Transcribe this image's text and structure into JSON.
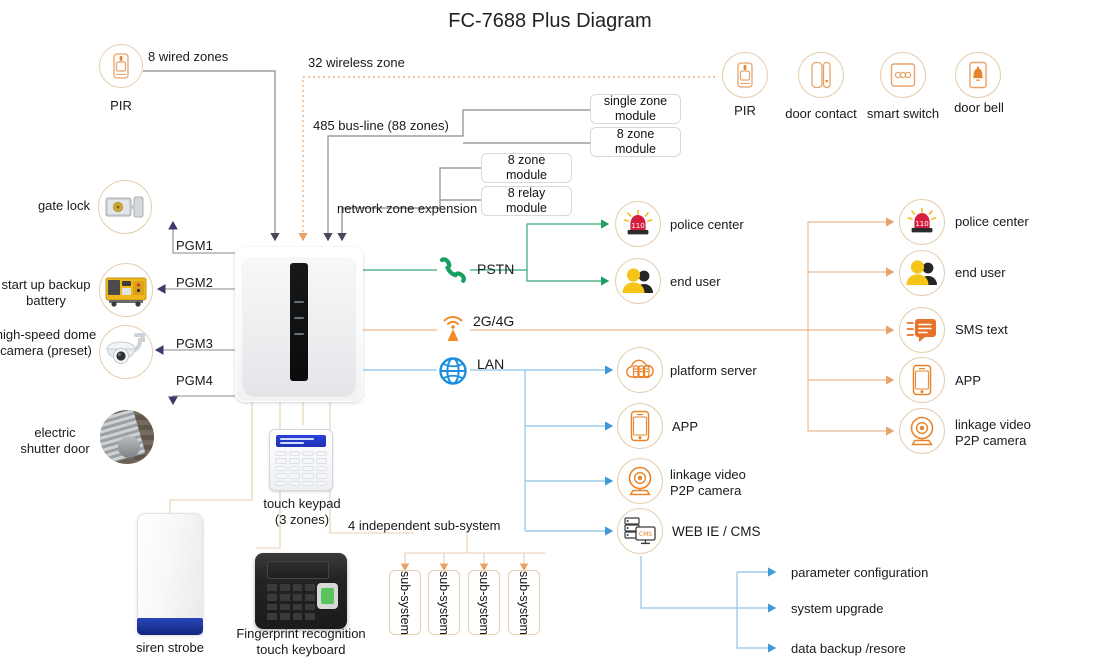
{
  "title": "FC-7688 Plus Diagram",
  "colors": {
    "orange": "#e8a36a",
    "orange_icon": "#e8832a",
    "green": "#1f9b63",
    "blue": "#59a9dd",
    "gray_line": "#8a8a8a",
    "dark_arrow": "#3b3a6b",
    "chip_border": "#e6cdb0"
  },
  "inputs": {
    "wired": {
      "label": "8 wired zones",
      "device": "PIR"
    },
    "wireless": {
      "label": "32 wireless zone"
    },
    "bus": {
      "label": "485 bus-line (88 zones)"
    },
    "network": {
      "label": "network zone expension"
    }
  },
  "modules": [
    {
      "name": "single zone module",
      "line1": "single zone",
      "line2": "module"
    },
    {
      "name": "8 zone module",
      "line1": "8 zone",
      "line2": "module"
    },
    {
      "name": "8 zone module",
      "line1": "8 zone",
      "line2": "module"
    },
    {
      "name": "8 relay module",
      "line1": "8 relay",
      "line2": "module"
    }
  ],
  "wireless_devices": [
    {
      "label": "PIR",
      "icon": "pir-icon"
    },
    {
      "label": "door contact",
      "icon": "door-contact-icon"
    },
    {
      "label": "smart switch",
      "icon": "smart-switch-icon"
    },
    {
      "label": "door bell",
      "icon": "door-bell-icon"
    }
  ],
  "pgm": [
    {
      "port": "PGM1",
      "label": "gate lock",
      "icon": "gate-lock-icon"
    },
    {
      "port": "PGM2",
      "label": "start up backup\nbattery",
      "icon": "backup-battery-icon"
    },
    {
      "port": "PGM3",
      "label": "high-speed dome\ncamera (preset)",
      "icon": "dome-camera-icon"
    },
    {
      "port": "PGM4",
      "label": "electric\nshutter door",
      "icon": "shutter-door-icon"
    }
  ],
  "comms": [
    {
      "name": "PSTN",
      "icon": "phone-icon",
      "color": "#1f9b63"
    },
    {
      "name": "2G/4G",
      "icon": "antenna-icon",
      "color": "#e8832a"
    },
    {
      "name": "LAN",
      "icon": "globe-icon",
      "color": "#1e8fe0"
    }
  ],
  "pstn_targets": [
    {
      "label": "police center",
      "icon": "police-siren-icon"
    },
    {
      "label": "end user",
      "icon": "end-user-icon"
    }
  ],
  "lan_targets": [
    {
      "label": "platform server",
      "icon": "cloud-server-icon"
    },
    {
      "label": "APP",
      "icon": "phone-app-icon"
    },
    {
      "label": "linkage video\nP2P camera",
      "icon": "p2p-camera-icon"
    },
    {
      "label": "WEB IE / CMS",
      "icon": "web-cms-icon"
    }
  ],
  "cell_targets": [
    {
      "label": "police center",
      "icon": "police-siren-icon"
    },
    {
      "label": "end user",
      "icon": "end-user-icon"
    },
    {
      "label": "SMS text",
      "icon": "sms-icon"
    },
    {
      "label": "APP",
      "icon": "phone-app-icon"
    },
    {
      "label": "linkage video\nP2P camera",
      "icon": "p2p-camera-icon"
    }
  ],
  "cms_functions": [
    "parameter configuration",
    "system upgrade",
    "data backup /resore"
  ],
  "local_devices": [
    {
      "label": "touch keypad\n(3 zones)",
      "name": "touch-keypad"
    },
    {
      "label": "Fingerprint recognition\ntouch keyboard",
      "name": "fingerprint-keyboard"
    },
    {
      "label": "siren strobe",
      "name": "siren-strobe"
    }
  ],
  "subsystems": {
    "caption": "4 independent sub-system",
    "items": [
      "sub-system",
      "sub-system",
      "sub-system",
      "sub-system"
    ]
  }
}
